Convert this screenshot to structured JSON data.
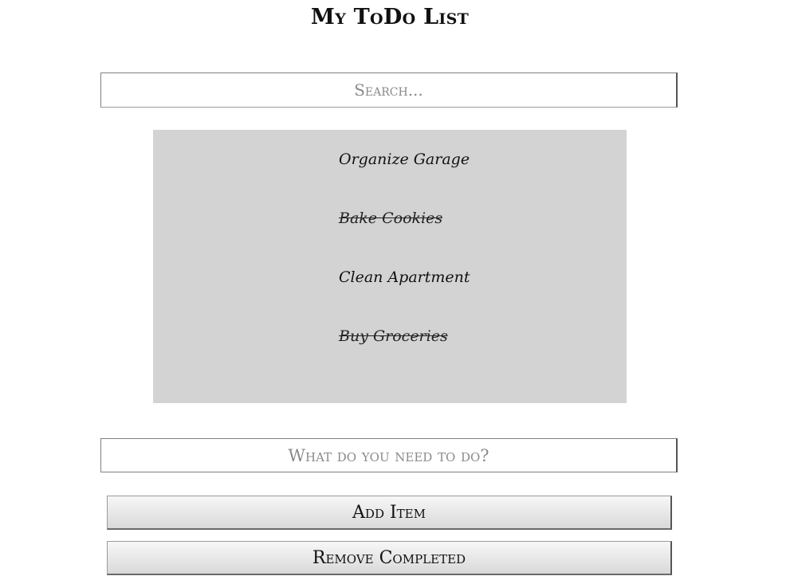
{
  "app": {
    "title": "My ToDo List"
  },
  "search": {
    "placeholder": "Search...",
    "value": ""
  },
  "todos": [
    {
      "label": "Organize Garage",
      "completed": false
    },
    {
      "label": "Bake Cookies",
      "completed": true
    },
    {
      "label": "Clean Apartment",
      "completed": false
    },
    {
      "label": "Buy Groceries",
      "completed": true
    }
  ],
  "new_item": {
    "placeholder": "What do you need to do?",
    "value": ""
  },
  "actions": {
    "add_label": "Add Item",
    "remove_label": "Remove Completed"
  },
  "colors": {
    "panel_background": "#d3d3d3",
    "page_background": "#ffffff",
    "text": "#111111"
  }
}
